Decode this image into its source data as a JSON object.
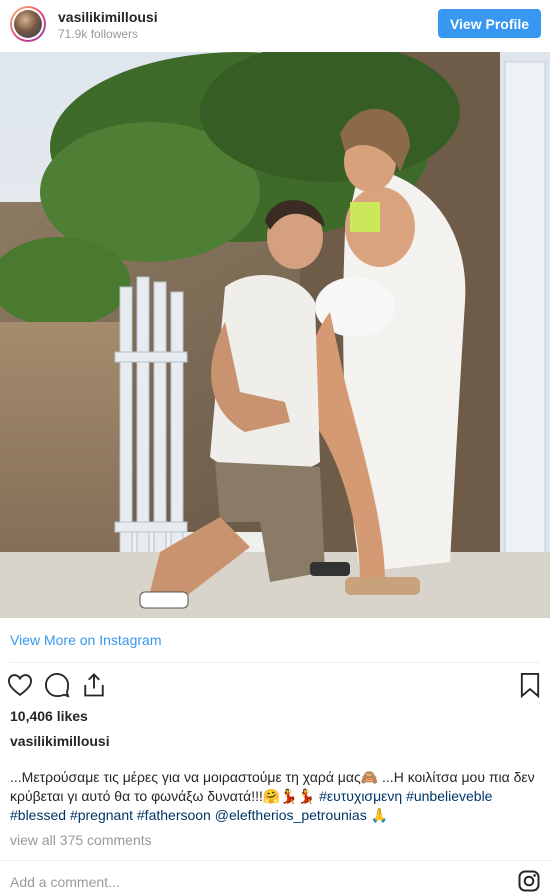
{
  "header": {
    "username": "vasilikimillousi",
    "followers": "71.9k followers",
    "view_profile_label": "View Profile"
  },
  "post": {
    "view_more_label": "View More on Instagram",
    "likes": "10,406 likes",
    "caption_user": "vasilikimillousi",
    "caption_text": "...Μετρούσαμε τις μέρες για να μοιραστούμε τη χαρά μας🙈 ...Η κοιλίτσα μου πια δεν κρύβεται γι αυτό θα το φωνάξω δυνατά!!!🤗💃💃",
    "hashtags": [
      "#ευτυχισμενη",
      "#unbelieveble",
      "#blessed",
      "#pregnant",
      "#fathersoon",
      "@eleftherios_petrounias"
    ],
    "caption_end": "🙏",
    "view_comments_label": "view all 375 comments",
    "add_comment_placeholder": "Add a comment..."
  },
  "icons": [
    "heart-icon",
    "comment-icon",
    "share-icon",
    "bookmark-icon",
    "instagram-icon"
  ],
  "colors": {
    "accent": "#3897f0",
    "hashtag": "#003569",
    "muted": "#999999"
  }
}
